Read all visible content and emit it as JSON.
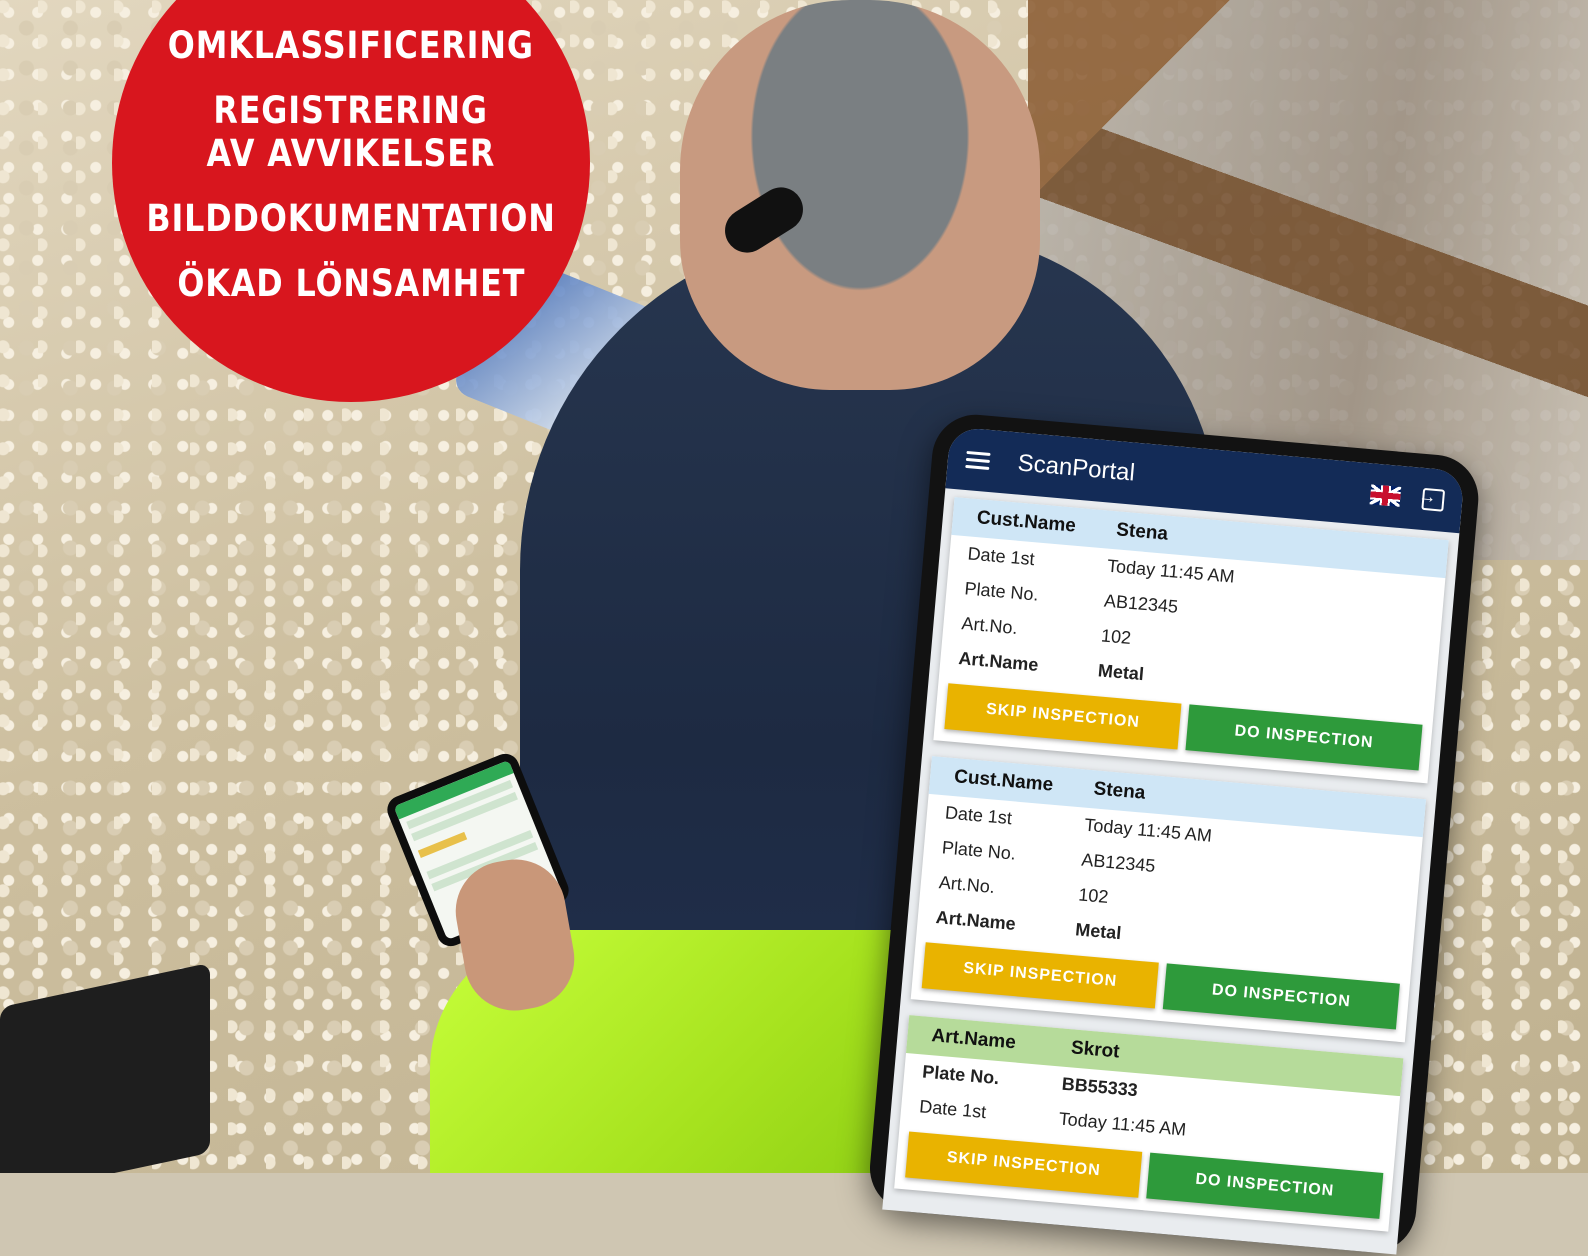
{
  "badge": {
    "lines": [
      "OMKLASSIFICERING",
      "REGISTRERING",
      "AV AVVIKELSER",
      "BILDDOKUMENTATION",
      "ÖKAD LÖNSAMHET"
    ],
    "color": "#d8161e"
  },
  "app": {
    "title": "ScanPortal",
    "icons": [
      "menu-icon",
      "uk-flag-icon",
      "logout-icon"
    ],
    "header_color": "#132b57"
  },
  "cards": [
    {
      "header": {
        "label": "Cust.Name",
        "value": "Stena"
      },
      "rows": [
        {
          "label": "Date 1st",
          "value": "Today 11:45 AM"
        },
        {
          "label": "Plate No.",
          "value": "AB12345"
        },
        {
          "label": "Art.No.",
          "value": "102"
        },
        {
          "label": "Art.Name",
          "value": "Metal"
        }
      ],
      "skip_label": "SKIP INSPECTION",
      "do_label": "DO INSPECTION"
    },
    {
      "header": {
        "label": "Cust.Name",
        "value": "Stena"
      },
      "rows": [
        {
          "label": "Date 1st",
          "value": "Today 11:45 AM"
        },
        {
          "label": "Plate No.",
          "value": "AB12345"
        },
        {
          "label": "Art.No.",
          "value": "102"
        },
        {
          "label": "Art.Name",
          "value": "Metal"
        }
      ],
      "skip_label": "SKIP INSPECTION",
      "do_label": "DO INSPECTION"
    },
    {
      "header": {
        "label": "Art.Name",
        "value": "Skrot"
      },
      "rows": [
        {
          "label": "Plate No.",
          "value": "BB55333"
        },
        {
          "label": "Date 1st",
          "value": "Today 11:45 AM"
        }
      ],
      "skip_label": "SKIP INSPECTION",
      "do_label": "DO INSPECTION"
    }
  ],
  "colors": {
    "skip_button": "#e9b300",
    "do_button": "#2e9a3b",
    "card_header_blue": "#cfe6f6",
    "card_header_green": "#b6db9a"
  }
}
